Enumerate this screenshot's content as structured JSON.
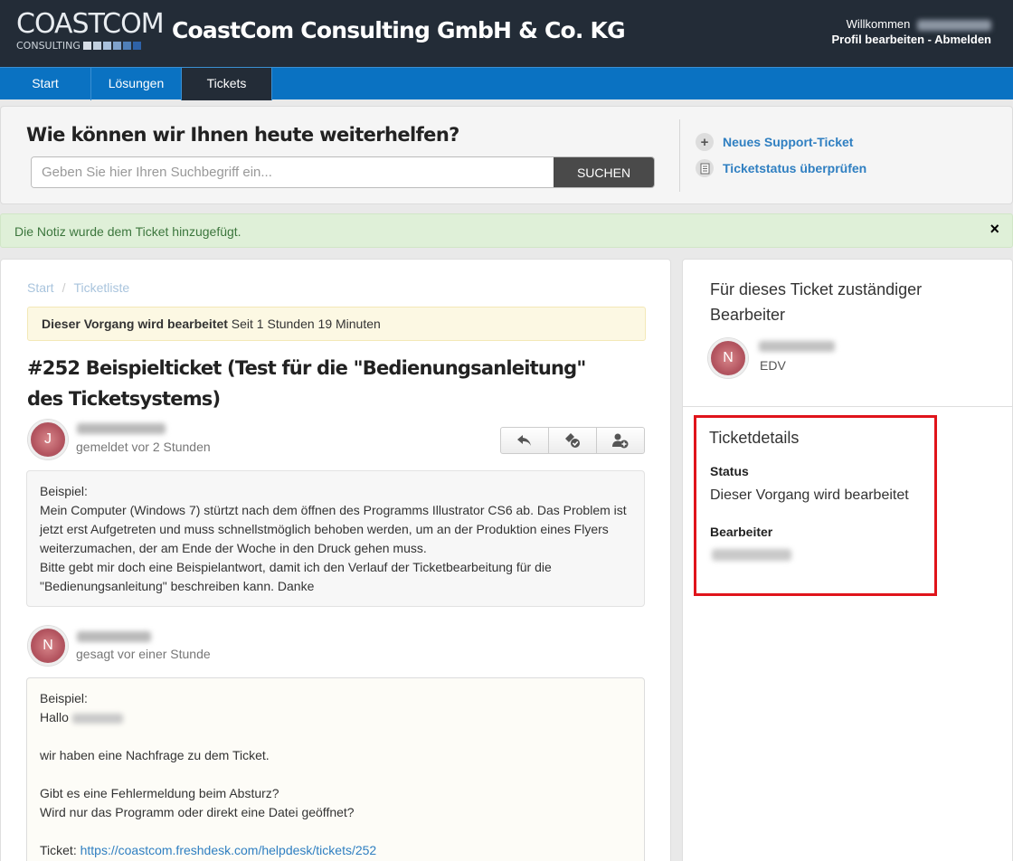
{
  "header": {
    "logo_main": "COASTCOM",
    "logo_sub": "CONSULTING",
    "logo_colors": [
      "#6f8aa8",
      "#8aa7c6",
      "#a9c1dc",
      "#4f7fb8",
      "#3c6fb0",
      "#2e62a8"
    ],
    "company_name": "CoastCom Consulting GmbH & Co. KG",
    "welcome": "Willkommen",
    "edit_profile": "Profil bearbeiten",
    "separator": "-",
    "logout": "Abmelden"
  },
  "nav": {
    "tabs": [
      {
        "label": "Start"
      },
      {
        "label": "Lösungen"
      },
      {
        "label": "Tickets"
      }
    ]
  },
  "search": {
    "title": "Wie können wir Ihnen heute weiterhelfen?",
    "placeholder": "Geben Sie hier Ihren Suchbegriff ein...",
    "button": "SUCHEN",
    "links": [
      {
        "label": "Neues Support-Ticket",
        "icon": "plus-icon"
      },
      {
        "label": "Ticketstatus überprüfen",
        "icon": "document-icon"
      }
    ]
  },
  "notice": {
    "text": "Die Notiz wurde dem Ticket hinzugefügt.",
    "close": "×"
  },
  "ticket": {
    "breadcrumb": [
      "Start",
      "Ticketliste"
    ],
    "status_bold": "Dieser Vorgang wird bearbeitet",
    "status_rest": " Seit 1 Stunden 19 Minuten",
    "title": "#252 Beispielticket (Test für die \"Bedienungsanleitung\" des Ticketsystems)",
    "messages": [
      {
        "avatar": "J",
        "meta": "gemeldet vor 2 Stunden",
        "lines": [
          "Beispiel:",
          "Mein Computer (Windows 7) stürtzt nach dem öffnen des Programms Illustrator CS6 ab. Das Problem ist jetzt erst Aufgetreten und muss schnellstmöglich behoben werden, um an der Produktion eines Flyers weiterzumachen, der am Ende der Woche in den Druck gehen muss.",
          "Bitte gebt mir doch eine Beispielantwort, damit ich den Verlauf der Ticketbearbeitung für die \"Bedienungsanleitung\" beschreiben kann. Danke"
        ]
      },
      {
        "avatar": "N",
        "meta": "gesagt vor einer Stunde",
        "line1": "Beispiel:",
        "greeting": "Hallo",
        "line2": "wir haben eine Nachfrage zu dem Ticket.",
        "line3": "Gibt es eine Fehlermeldung beim Absturz?",
        "line4": "Wird nur das Programm oder direkt eine Datei geöffnet?",
        "ticket_label": "Ticket:",
        "ticket_link": "https://coastcom.freshdesk.com/helpdesk/tickets/252"
      }
    ],
    "actions": [
      "reply-icon",
      "close-ticket-icon",
      "add-watcher-icon"
    ]
  },
  "sidebar": {
    "agent_title": "Für dieses Ticket zuständiger Bearbeiter",
    "agent_avatar": "N",
    "agent_dept": "EDV",
    "details_title": "Ticketdetails",
    "status_label": "Status",
    "status_value": "Dieser Vorgang wird bearbeitet",
    "agent_label": "Bearbeiter"
  }
}
